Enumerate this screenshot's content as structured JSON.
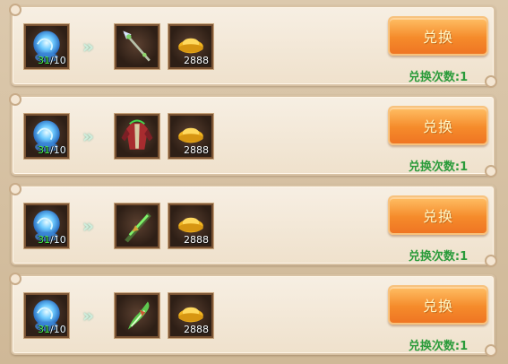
{
  "offers": [
    {
      "material": {
        "owned": "31",
        "required": "/10",
        "icon": "blue-crystal-orb-icon"
      },
      "reward": {
        "icon": "spear-icon"
      },
      "currency": {
        "quantity": "2888",
        "icon": "gold-ingot-icon"
      },
      "button_label": "兑换",
      "times_text": "兑换次数:1"
    },
    {
      "material": {
        "owned": "31",
        "required": "/10",
        "icon": "blue-crystal-orb-icon"
      },
      "reward": {
        "icon": "red-robe-armor-icon"
      },
      "currency": {
        "quantity": "2888",
        "icon": "gold-ingot-icon"
      },
      "button_label": "兑换",
      "times_text": "兑换次数:1"
    },
    {
      "material": {
        "owned": "31",
        "required": "/10",
        "icon": "blue-crystal-orb-icon"
      },
      "reward": {
        "icon": "green-blade-icon"
      },
      "currency": {
        "quantity": "2888",
        "icon": "gold-ingot-icon"
      },
      "button_label": "兑换",
      "times_text": "兑换次数:1"
    },
    {
      "material": {
        "owned": "31",
        "required": "/10",
        "icon": "blue-crystal-orb-icon"
      },
      "reward": {
        "icon": "green-flame-sword-icon"
      },
      "currency": {
        "quantity": "2888",
        "icon": "gold-ingot-icon"
      },
      "button_label": "兑换",
      "times_text": "兑换次数:1"
    }
  ],
  "colors": {
    "button_orange": "#f58b2b",
    "times_green": "#2a9b3a",
    "owned_green": "#49f04d"
  }
}
